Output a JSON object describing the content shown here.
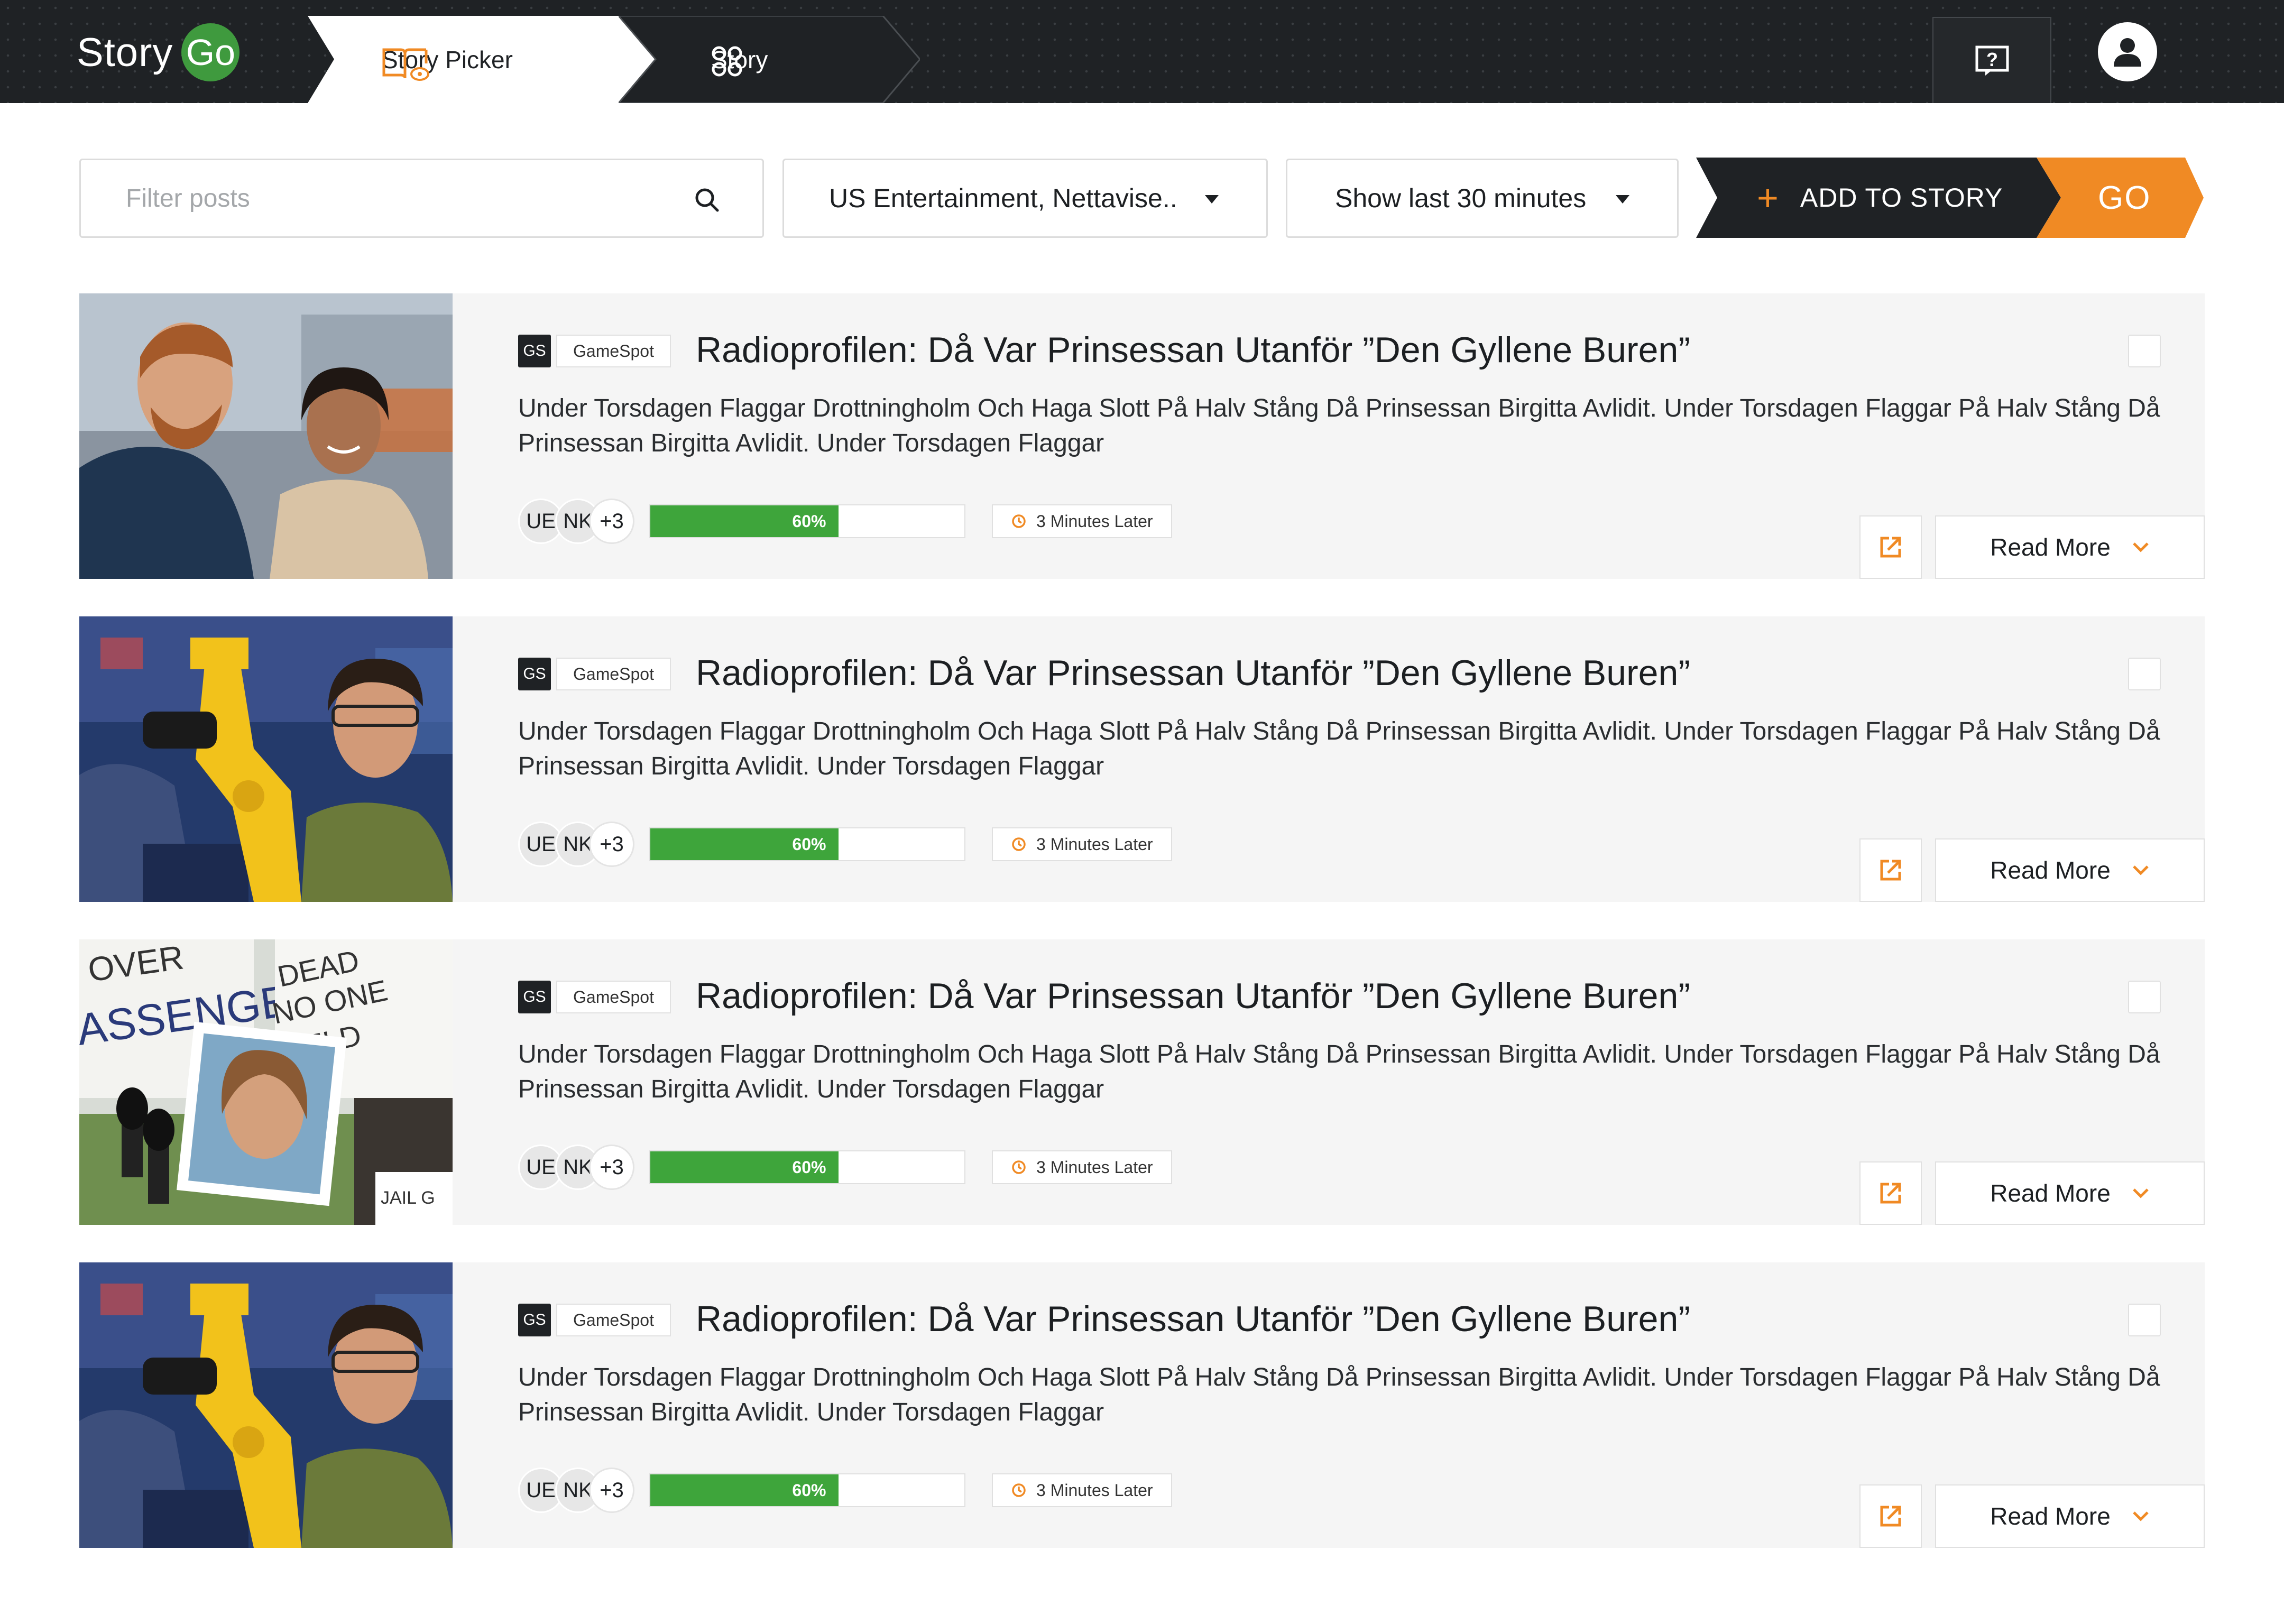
{
  "header": {
    "logo_word": "Story",
    "logo_go": "Go",
    "tabs": [
      {
        "label": "Story Picker",
        "active": true
      },
      {
        "label": "Story",
        "active": false
      }
    ]
  },
  "toolbar": {
    "filter_placeholder": "Filter posts",
    "source_dropdown": "US Entertainment, Nettavise..",
    "time_dropdown": "Show last 30 minutes",
    "add_label": "ADD TO STORY",
    "go_label": "GO"
  },
  "colors": {
    "header_bg": "#1f2225",
    "accent_orange": "#f08a24",
    "logo_green": "#3f9a3e",
    "progress_green": "#3ea53b",
    "card_bg": "#f5f5f5"
  },
  "posts": [
    {
      "source_abbr": "GS",
      "source_name": "GameSpot",
      "title": "Radioprofilen: Då Var Prinsessan Utanför ”Den Gyllene Buren”",
      "body": "Under Torsdagen Flaggar Drottningholm Och Haga Slott På Halv Stång Då Prinsessan Birgitta Avlidit. Under Torsdagen Flaggar På Halv Stång Då Prinsessan Birgitta Avlidit. Under Torsdagen Flaggar",
      "avatars": [
        "UE",
        "NK"
      ],
      "more_count": "+3",
      "progress_label": "60%",
      "progress_fraction": 0.6,
      "time": "3 Minutes Later",
      "read_more": "Read More",
      "image": "couple-photo"
    },
    {
      "source_abbr": "GS",
      "source_name": "GameSpot",
      "title": "Radioprofilen: Då Var Prinsessan Utanför ”Den Gyllene Buren”",
      "body": "Under Torsdagen Flaggar Drottningholm Och Haga Slott På Halv Stång Då Prinsessan Birgitta Avlidit. Under Torsdagen Flaggar På Halv Stång Då Prinsessan Birgitta Avlidit. Under Torsdagen Flaggar",
      "avatars": [
        "UE",
        "NK"
      ],
      "more_count": "+3",
      "progress_label": "60%",
      "progress_fraction": 0.6,
      "time": "3 Minutes Later",
      "read_more": "Read More",
      "image": "robot-arm-photo"
    },
    {
      "source_abbr": "GS",
      "source_name": "GameSpot",
      "title": "Radioprofilen: Då Var Prinsessan Utanför ”Den Gyllene Buren”",
      "body": "Under Torsdagen Flaggar Drottningholm Och Haga Slott På Halv Stång Då Prinsessan Birgitta Avlidit. Under Torsdagen Flaggar På Halv Stång Då Prinsessan Birgitta Avlidit. Under Torsdagen Flaggar",
      "avatars": [
        "UE",
        "NK"
      ],
      "more_count": "+3",
      "progress_label": "60%",
      "progress_fraction": 0.6,
      "time": "3 Minutes Later",
      "read_more": "Read More",
      "image": "protest-photo"
    },
    {
      "source_abbr": "GS",
      "source_name": "GameSpot",
      "title": "Radioprofilen: Då Var Prinsessan Utanför ”Den Gyllene Buren”",
      "body": "Under Torsdagen Flaggar Drottningholm Och Haga Slott På Halv Stång Då Prinsessan Birgitta Avlidit. Under Torsdagen Flaggar På Halv Stång Då Prinsessan Birgitta Avlidit. Under Torsdagen Flaggar",
      "avatars": [
        "UE",
        "NK"
      ],
      "more_count": "+3",
      "progress_label": "60%",
      "progress_fraction": 0.6,
      "time": "3 Minutes Later",
      "read_more": "Read More",
      "image": "robot-arm-photo"
    }
  ]
}
